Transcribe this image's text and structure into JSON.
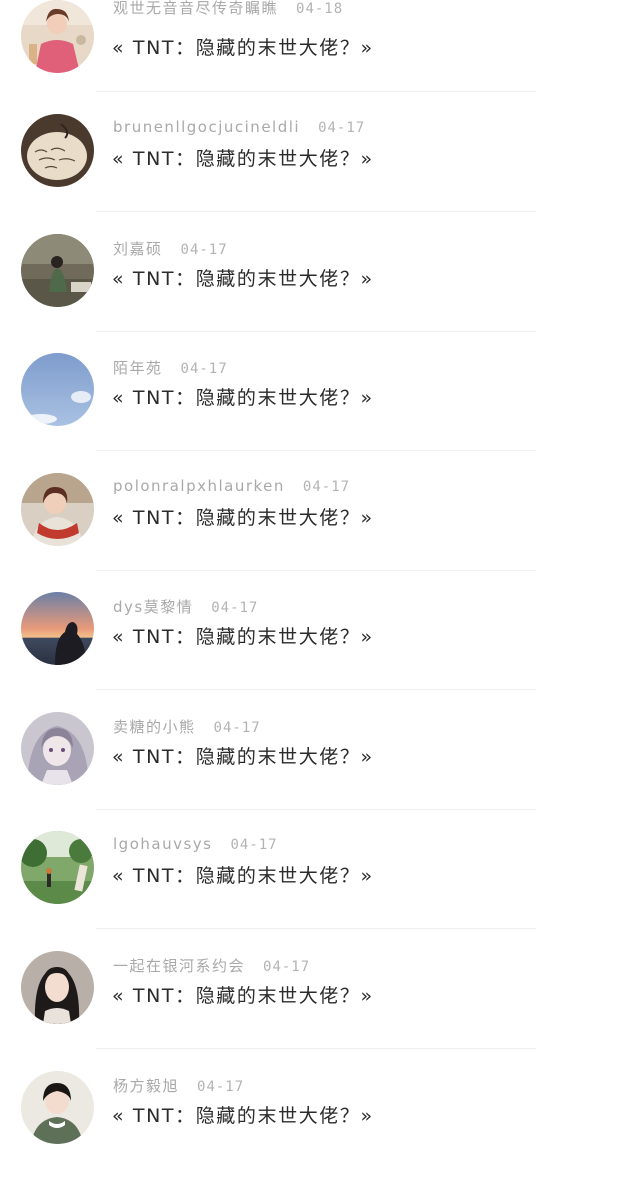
{
  "comments": [
    {
      "user": "观世无音音尽传奇瞩瞧",
      "date": "04-18",
      "text": "« TNT：隐藏的末世大佬？»",
      "avatar": "woman-red-dress"
    },
    {
      "user": "brunenllgocjucineldli",
      "date": "04-17",
      "text": "« TNT：隐藏的末世大佬？»",
      "avatar": "handwritten-note"
    },
    {
      "user": "刘嘉硕",
      "date": "04-17",
      "text": "« TNT：隐藏的末世大佬？»",
      "avatar": "person-outdoors"
    },
    {
      "user": "陌年苑",
      "date": "04-17",
      "text": "« TNT：隐藏的末世大佬？»",
      "avatar": "blue-sky"
    },
    {
      "user": "polonralpxhlaurken",
      "date": "04-17",
      "text": "« TNT：隐藏的末世大佬？»",
      "avatar": "girl-red-scarf"
    },
    {
      "user": "dys莫黎情",
      "date": "04-17",
      "text": "« TNT：隐藏的末世大佬？»",
      "avatar": "sunset-silhouette"
    },
    {
      "user": "卖糖的小熊",
      "date": "04-17",
      "text": "« TNT：隐藏的末世大佬？»",
      "avatar": "anime-girl"
    },
    {
      "user": "lgohauvsys",
      "date": "04-17",
      "text": "« TNT：隐藏的末世大佬？»",
      "avatar": "green-park"
    },
    {
      "user": "一起在银河系约会",
      "date": "04-17",
      "text": "« TNT：隐藏的末世大佬？»",
      "avatar": "long-hair-girl"
    },
    {
      "user": "杨方毅旭",
      "date": "04-17",
      "text": "« TNT：隐藏的末世大佬？»",
      "avatar": "child-portrait"
    }
  ]
}
